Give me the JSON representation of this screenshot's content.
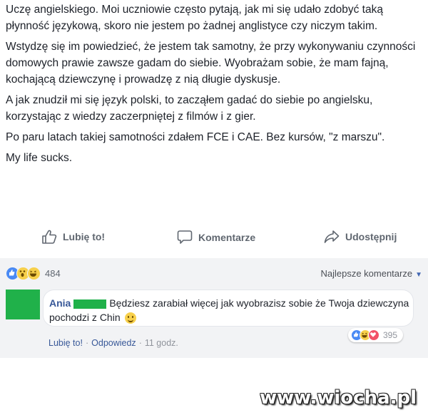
{
  "post": {
    "paragraphs": [
      "Uczę angielskiego. Moi uczniowie często pytają, jak mi się udało zdobyć taką płynność językową, skoro nie jestem po żadnej anglistyce czy niczym takim.",
      "Wstydzę się im powiedzieć, że jestem tak samotny, że przy wykonywaniu czynności domowych prawie zawsze gadam do siebie. Wyobrażam sobie, że mam fajną, kochającą dziewczynę i prowadzę z nią długie dyskusje.",
      "A jak znudził mi się język polski, to zacząłem gadać do siebie po angielsku, korzystając z wiedzy zaczerpniętej z filmów i z gier.",
      "Po paru latach takiej samotności zdałem FCE i CAE. Bez kursów, \"z marszu\".",
      "My life sucks."
    ]
  },
  "actions": {
    "like": "Lubię to!",
    "comment": "Komentarze",
    "share": "Udostępnij"
  },
  "reactions": {
    "count": "484",
    "sort_label": "Najlepsze komentarze",
    "types": [
      "like",
      "wow",
      "haha"
    ],
    "colors": {
      "like": "#4a8af4",
      "wow": "#f7d04b",
      "haha": "#f7d04b",
      "love": "#f25268"
    }
  },
  "comment": {
    "author": "Ania",
    "text": "Będziesz zarabiał więcej jak wyobrazisz sobie że Twoja dziewczyna pochodzi z Chin",
    "reaction_count": "395",
    "reaction_types": [
      "like",
      "haha",
      "love"
    ],
    "like_label": "Lubię to!",
    "reply_label": "Odpowiedz",
    "time": "11 godz."
  },
  "watermark": "www.wiocha.pl"
}
